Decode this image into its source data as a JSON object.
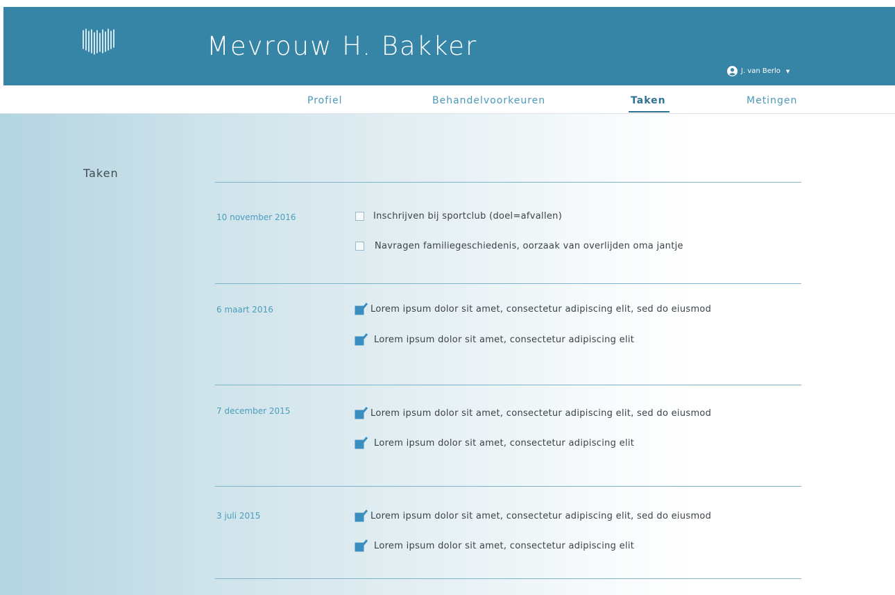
{
  "header": {
    "patient_name": "Mevrouw H. Bakker",
    "user_name": "J. van Berlo",
    "brand_color": "#3685a6"
  },
  "nav": {
    "tabs": [
      {
        "label": "Profiel",
        "active": false
      },
      {
        "label": "Behandelvoorkeuren",
        "active": false
      },
      {
        "label": "Taken",
        "active": true
      },
      {
        "label": "Metingen",
        "active": false
      }
    ]
  },
  "main": {
    "section_title": "Taken",
    "groups": [
      {
        "date": "10 november 2016",
        "tasks": [
          {
            "label": "Inschrijven bij sportclub (doel=afvallen)",
            "checked": false
          },
          {
            "label": "Navragen familiegeschiedenis, oorzaak van overlijden oma jantje",
            "checked": false
          }
        ]
      },
      {
        "date": "6 maart 2016",
        "tasks": [
          {
            "label": "Lorem ipsum dolor sit amet, consectetur adipiscing elit, sed do eiusmod",
            "checked": true
          },
          {
            "label": "Lorem ipsum dolor sit amet, consectetur adipiscing elit",
            "checked": true
          }
        ]
      },
      {
        "date": "7 december 2015",
        "tasks": [
          {
            "label": "Lorem ipsum dolor sit amet, consectetur adipiscing elit, sed do eiusmod",
            "checked": true
          },
          {
            "label": "Lorem ipsum dolor sit amet, consectetur adipiscing elit",
            "checked": true
          }
        ]
      },
      {
        "date": "3 juli 2015",
        "tasks": [
          {
            "label": "Lorem ipsum dolor sit amet, consectetur adipiscing elit, sed do eiusmod",
            "checked": true
          },
          {
            "label": "Lorem ipsum dolor sit amet, consectetur adipiscing elit",
            "checked": true
          }
        ]
      }
    ]
  }
}
